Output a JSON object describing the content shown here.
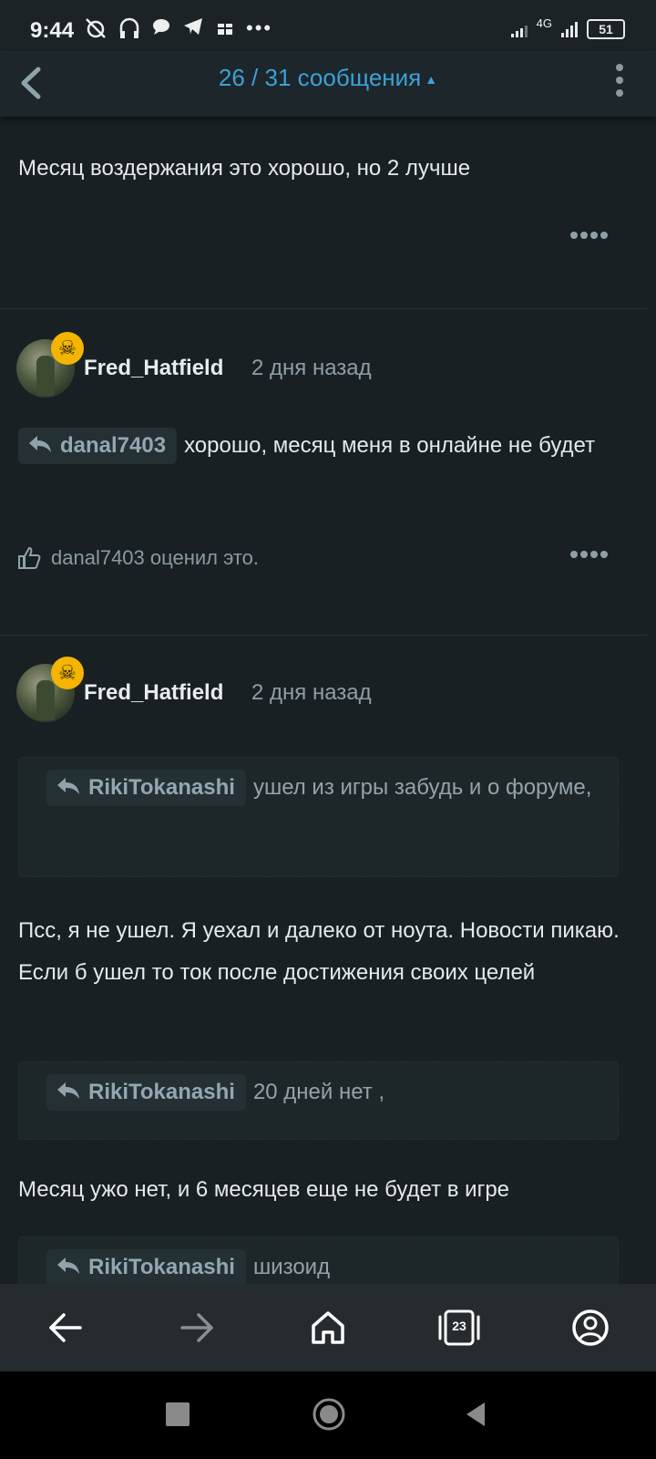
{
  "status_bar": {
    "time": "9:44",
    "network": "4G",
    "battery": "51"
  },
  "header": {
    "page_counter": "26 / 31 сообщения"
  },
  "posts": [
    {
      "body": "Месяц воздержания это хорошо, но 2 лучше"
    },
    {
      "author": "Fred_Hatfield",
      "time": "2 дня назад",
      "reply_to": "danal7403",
      "body": "хорошо, месяц меня в онлайне не будет",
      "reaction": "danal7403 оценил это."
    },
    {
      "author": "Fred_Hatfield",
      "time": "2 дня назад",
      "quotes": [
        {
          "author": "RikiTokanashi",
          "text": "ушел из игры забудь и о форуме,"
        },
        {
          "author": "RikiTokanashi",
          "text": "20 дней нет ,"
        },
        {
          "author": "RikiTokanashi",
          "text": "шизоид"
        }
      ],
      "body_1": "Псс, я не ушел. Я уехал и далеко от ноута. Новости пикаю. Если б ушел то ток после достижения своих целей",
      "body_2": "Месяц ужо нет, и 6 месяцев еще не будет в игре"
    }
  ],
  "bottom_nav": {
    "tabs_count": "23"
  },
  "colors": {
    "background": "#182024",
    "accent": "#3ba1d8",
    "badge": "#f4b400",
    "muted_text": "#8f9ea6"
  }
}
